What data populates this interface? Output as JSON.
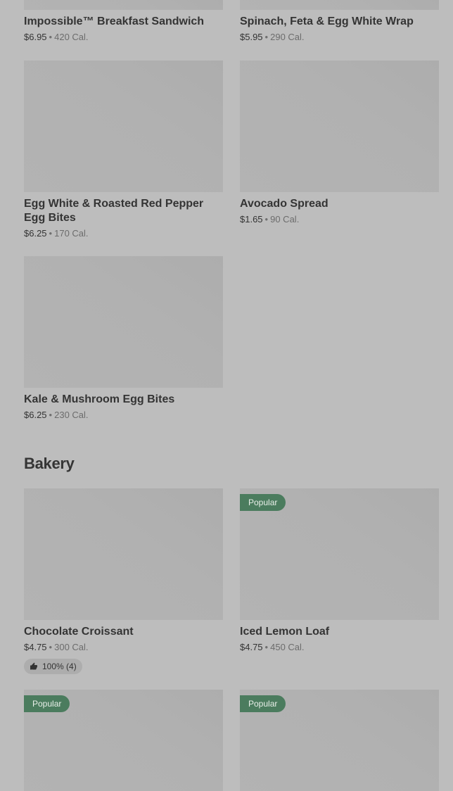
{
  "items_top": [
    {
      "name": "Impossible™ Breakfast Sandwich",
      "price": "$6.95",
      "cal": "420 Cal."
    },
    {
      "name": "Spinach, Feta & Egg White Wrap",
      "price": "$5.95",
      "cal": "290 Cal."
    },
    {
      "name": "Egg White & Roasted Red Pepper Egg Bites",
      "price": "$6.25",
      "cal": "170 Cal."
    },
    {
      "name": "Avocado Spread",
      "price": "$1.65",
      "cal": "90 Cal."
    },
    {
      "name": "Kale & Mushroom Egg Bites",
      "price": "$6.25",
      "cal": "230 Cal."
    }
  ],
  "bakery": {
    "title": "Bakery",
    "items": [
      {
        "name": "Chocolate Croissant",
        "price": "$4.75",
        "cal": "300 Cal.",
        "rating": "100% (4)"
      },
      {
        "name": "Iced Lemon Loaf",
        "price": "$4.75",
        "cal": "450 Cal.",
        "badge": "Popular"
      },
      {
        "badge": "Popular"
      },
      {
        "badge": "Popular"
      }
    ]
  },
  "separator": "•",
  "colors": {
    "badge_bg": "#4b7c5e",
    "overlay": "#bdbdbd"
  },
  "icons": {
    "rating": "thumbs-up-icon"
  }
}
